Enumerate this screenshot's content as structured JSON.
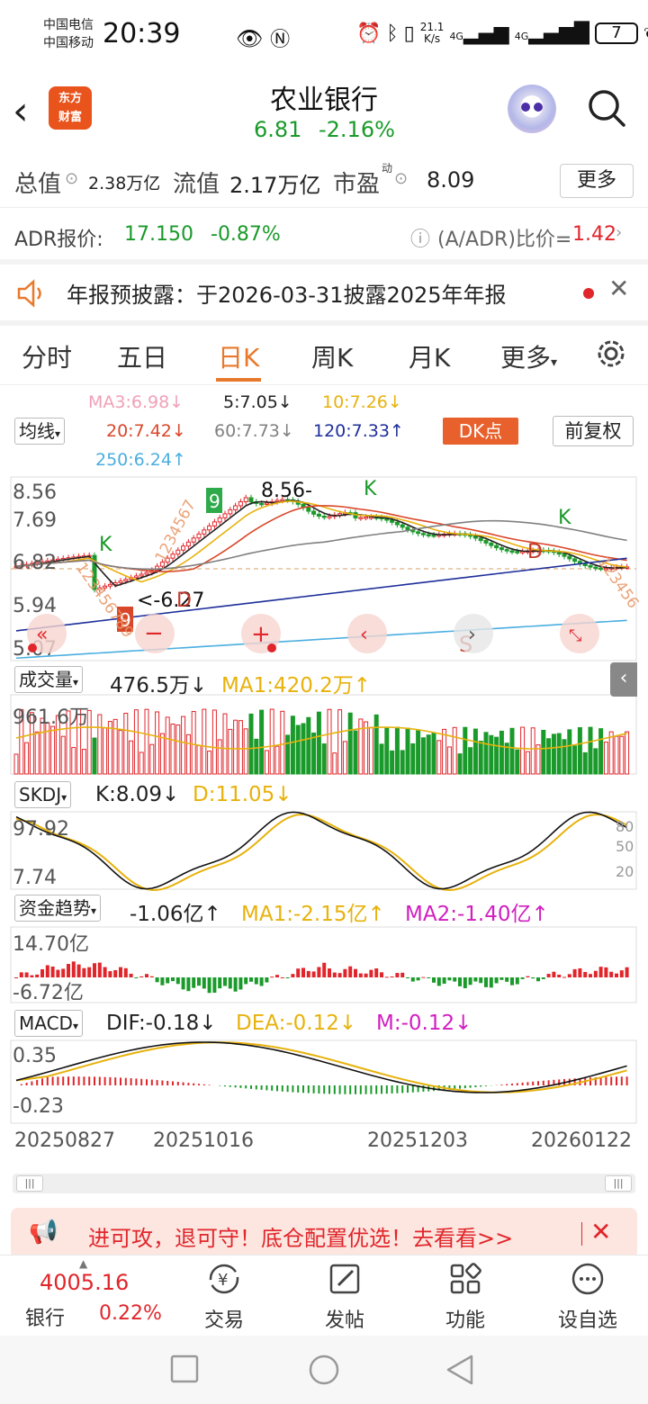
{
  "status": {
    "carrier1": "中国电信",
    "carrier2": "中国移动",
    "time": "20:39",
    "net_speed_value": "21.1",
    "net_speed_unit": "K/s",
    "signal1": "4G",
    "signal2": "4G",
    "battery": "7"
  },
  "header": {
    "logo_line1": "东方",
    "logo_line2": "财富",
    "stock_name": "农业银行",
    "price": "6.81",
    "change": "-2.16%"
  },
  "info": {
    "total_value_label": "总值",
    "total_value": "2.38万亿",
    "float_value_label": "流值",
    "float_value": "2.17万亿",
    "pe_label": "市盈",
    "pe_sup": "动",
    "pe_value": "8.09",
    "more": "更多",
    "adr_label": "ADR报价:",
    "adr_price": "17.150",
    "adr_change": "-0.87%",
    "adr_ratio_label": "(A/ADR)比价=",
    "adr_ratio": "1.42"
  },
  "notice": {
    "text": "年报预披露：于2026-03-31披露2025年年报"
  },
  "tabs": [
    "分时",
    "五日",
    "日K",
    "周K",
    "月K",
    "更多"
  ],
  "active_tab": "日K",
  "kline_header": {
    "ma_select": "均线",
    "ma3": "MA3:6.98↓",
    "ma5": "5:7.05↓",
    "ma10": "10:7.26↓",
    "ma20": "20:7.42↓",
    "ma60": "60:7.73↓",
    "ma120": "120:7.33↑",
    "ma250": "250:6.24↑",
    "dk_button": "DK点",
    "adjust": "前复权"
  },
  "kline": {
    "y_ticks": [
      "8.56",
      "7.69",
      "6.82",
      "5.94",
      "5.07"
    ],
    "high_label": "8.56-",
    "low_label": "<-6.27",
    "marks": [
      "K",
      "K",
      "K",
      "D",
      "D",
      "S"
    ],
    "td_count_1": "9",
    "td_count_2": "9",
    "td_seq_1": "123456789",
    "td_seq_2": "1234567",
    "td_seq_3": "123456"
  },
  "colors": {
    "up": "#e0262b",
    "down": "#1a9a2a",
    "accent": "#e8792c",
    "ma3": "#f0a0b8",
    "ma5": "#222222",
    "ma10": "#e7b20c",
    "ma20": "#d9472a",
    "ma60": "#808080",
    "ma120": "#1e2f9a",
    "ma250": "#4aaee0"
  },
  "volume": {
    "select": "成交量",
    "value": "476.5万↓",
    "ma1": "MA1:420.2万↑",
    "y_top": "961.6万"
  },
  "skdj": {
    "select": "SKDJ",
    "k": "K:8.09↓",
    "d": "D:11.05↓",
    "y_top": "97.92",
    "y_bottom": "7.74",
    "levels": [
      "80",
      "50",
      "20"
    ]
  },
  "fund": {
    "select": "资金趋势",
    "value": "-1.06亿↑",
    "ma1": "MA1:-2.15亿↑",
    "ma2": "MA2:-1.40亿↑",
    "y_top": "14.70亿",
    "y_bottom": "-6.72亿"
  },
  "macd": {
    "select": "MACD",
    "dif": "DIF:-0.18↓",
    "dea": "DEA:-0.12↓",
    "m": "M:-0.12↓",
    "y_top": "0.35",
    "y_bottom": "-0.23"
  },
  "x_dates": [
    "20250827",
    "20251016",
    "20251203",
    "20260122"
  ],
  "promo": {
    "text": "进可攻，退可守！底仓配置优选！去看看>>"
  },
  "bottom": {
    "index_value": "4005.16",
    "index_name": "银行",
    "index_pct": "0.22%",
    "nav": [
      "交易",
      "发帖",
      "功能",
      "设自选"
    ]
  }
}
